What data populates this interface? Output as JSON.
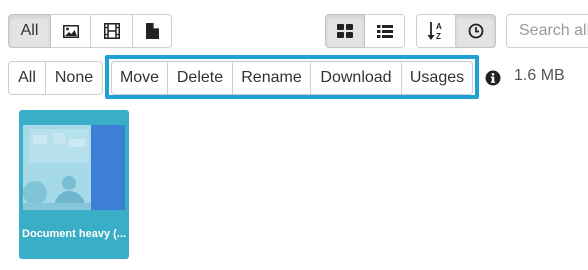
{
  "filter_bar": {
    "all_label": "All",
    "image_filter_icon": "image-icon",
    "video_filter_icon": "film-icon",
    "document_filter_icon": "document-icon"
  },
  "view_toggle": {
    "grid_icon": "grid-view-icon",
    "list_icon": "list-view-icon"
  },
  "sort": {
    "alpha_icon": "sort-alpha-icon",
    "recent_icon": "clock-icon"
  },
  "search": {
    "placeholder": "Search all"
  },
  "selection": {
    "all_label": "All",
    "none_label": "None"
  },
  "actions": {
    "move_label": "Move",
    "delete_label": "Delete",
    "rename_label": "Rename",
    "download_label": "Download",
    "usages_label": "Usages"
  },
  "info": {
    "icon": "info-icon",
    "size_text": "1.6 MB"
  },
  "files": [
    {
      "caption": "Document heavy (...",
      "type": "image"
    }
  ],
  "colors": {
    "highlight": "#1ea0d3",
    "tile_background": "#3aaec6",
    "active_button": "#e4e4e4"
  }
}
